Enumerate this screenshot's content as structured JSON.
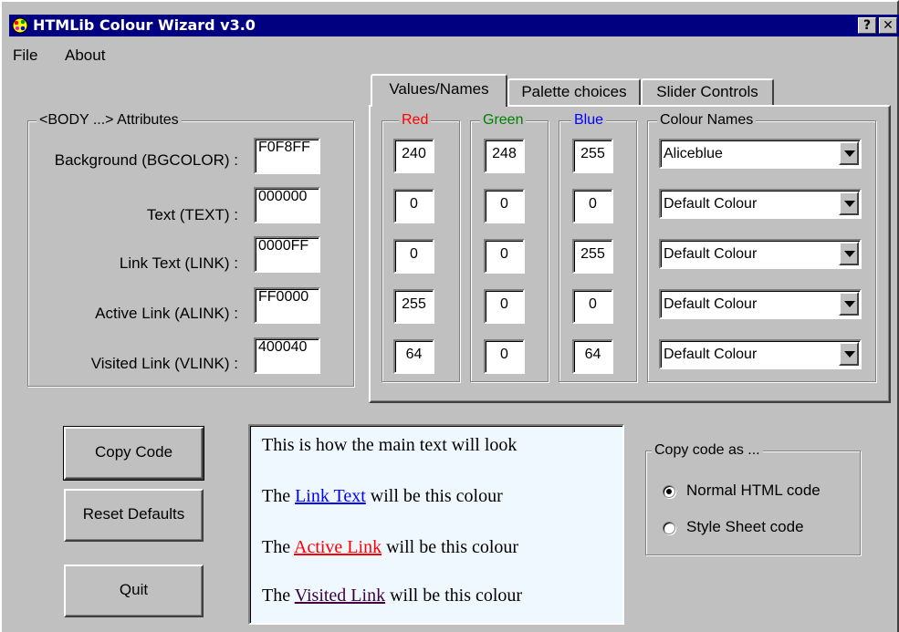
{
  "window": {
    "title": "HTMLib Colour Wizard v3.0",
    "help_label": "?",
    "close_label": "✕"
  },
  "menu": {
    "file": "File",
    "about": "About"
  },
  "body_group": {
    "legend": "<BODY ...> Attributes",
    "rows": [
      {
        "label": "Background (BGCOLOR) :",
        "value": "F0F8FF"
      },
      {
        "label": "Text (TEXT) :",
        "value": "000000"
      },
      {
        "label": "Link Text (LINK) :",
        "value": "0000FF"
      },
      {
        "label": "Active Link (ALINK) :",
        "value": "FF0000"
      },
      {
        "label": "Visited Link (VLINK) :",
        "value": "400040"
      }
    ]
  },
  "tabs": [
    {
      "label": "Values/Names",
      "active": true
    },
    {
      "label": "Palette choices",
      "active": false
    },
    {
      "label": "Slider Controls",
      "active": false
    }
  ],
  "channels": {
    "red": {
      "label": "Red",
      "color": "#ff0000",
      "values": [
        "240",
        "0",
        "0",
        "255",
        "64"
      ]
    },
    "green": {
      "label": "Green",
      "color": "#008000",
      "values": [
        "248",
        "0",
        "0",
        "0",
        "0"
      ]
    },
    "blue": {
      "label": "Blue",
      "color": "#0000ff",
      "values": [
        "255",
        "0",
        "255",
        "0",
        "64"
      ]
    }
  },
  "colour_names": {
    "legend": "Colour Names",
    "values": [
      "Aliceblue",
      "Default Colour",
      "Default Colour",
      "Default Colour",
      "Default Colour"
    ]
  },
  "buttons": {
    "copy": "Copy Code",
    "reset": "Reset Defaults",
    "quit": "Quit"
  },
  "preview": {
    "background": "#f0f8ff",
    "main_text": "This is how the main text will look",
    "the": "The",
    "suffix": "will be this colour",
    "link_text": "Link Text",
    "active_link": "Active Link",
    "visited_link": "Visited Link",
    "colors": {
      "text": "#000000",
      "link": "#0000ff",
      "alink": "#ff0000",
      "vlink": "#400040"
    }
  },
  "copy_as": {
    "legend": "Copy code as ...",
    "options": [
      "Normal HTML code",
      "Style Sheet code"
    ],
    "selected": "Normal HTML code"
  }
}
